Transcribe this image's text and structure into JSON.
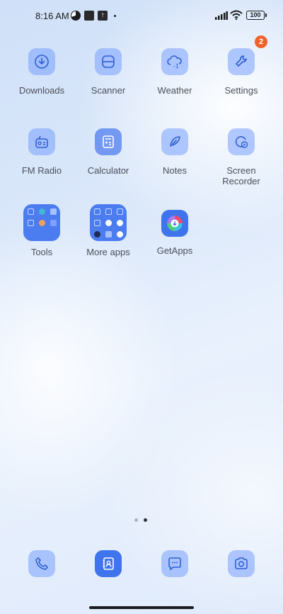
{
  "status_bar": {
    "time": "8:16 AM",
    "battery": "100",
    "icons": [
      "pie-notification-icon",
      "square-notification-icon",
      "upload-notification-icon",
      "signal-icon",
      "wifi-icon",
      "battery-icon"
    ]
  },
  "apps": [
    {
      "label": "Downloads",
      "icon": "download-icon"
    },
    {
      "label": "Scanner",
      "icon": "scanner-icon"
    },
    {
      "label": "Weather",
      "icon": "weather-icon"
    },
    {
      "label": "Settings",
      "icon": "wrench-icon",
      "badge": "2"
    },
    {
      "label": "FM Radio",
      "icon": "radio-icon"
    },
    {
      "label": "Calculator",
      "icon": "calculator-icon"
    },
    {
      "label": "Notes",
      "icon": "feather-icon"
    },
    {
      "label": "Screen Recorder",
      "icon": "screen-recorder-icon"
    },
    {
      "label": "Tools",
      "icon": "folder-icon"
    },
    {
      "label": "More apps",
      "icon": "folder-icon"
    },
    {
      "label": "GetApps",
      "icon": "getapps-icon"
    }
  ],
  "page_indicator": {
    "count": 2,
    "active_index": 1
  },
  "dock": [
    {
      "name": "phone",
      "icon": "phone-icon"
    },
    {
      "name": "contacts",
      "icon": "contacts-icon"
    },
    {
      "name": "messages",
      "icon": "message-icon"
    },
    {
      "name": "camera",
      "icon": "camera-icon"
    }
  ],
  "colors": {
    "accent": "#3f74ec",
    "badge": "#f2612b",
    "icon_tint": "#2f5fd0"
  }
}
